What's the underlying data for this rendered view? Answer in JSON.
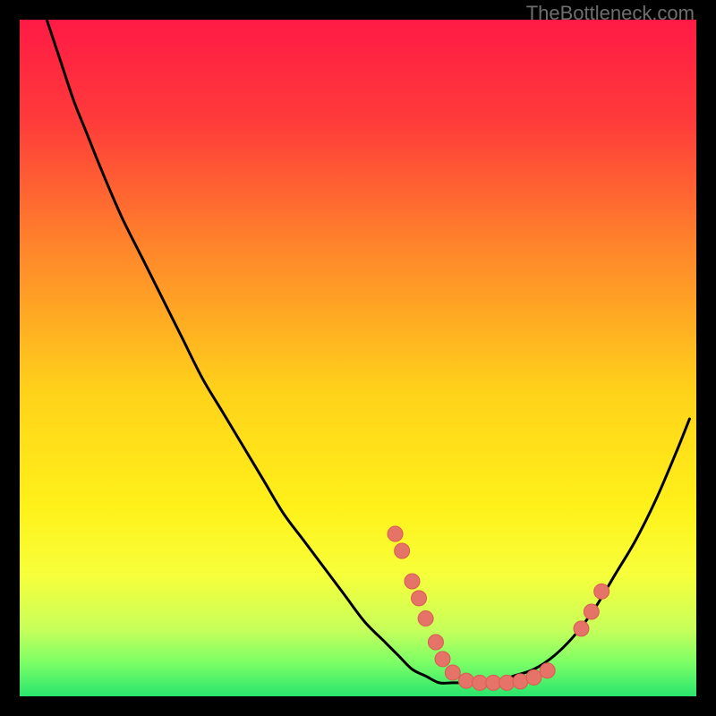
{
  "watermark": "TheBottleneck.com",
  "colors": {
    "background": "#000000",
    "curve": "#000000",
    "marker_fill": "#e57368",
    "marker_stroke": "#d95b52",
    "gradient_stops": [
      {
        "offset": 0.0,
        "color": "#ff1a45"
      },
      {
        "offset": 0.15,
        "color": "#ff3b3a"
      },
      {
        "offset": 0.35,
        "color": "#ff8a2a"
      },
      {
        "offset": 0.55,
        "color": "#ffd21a"
      },
      {
        "offset": 0.72,
        "color": "#fff11a"
      },
      {
        "offset": 0.82,
        "color": "#f7ff3a"
      },
      {
        "offset": 0.9,
        "color": "#c8ff5a"
      },
      {
        "offset": 0.95,
        "color": "#7dff66"
      },
      {
        "offset": 1.0,
        "color": "#29e56d"
      }
    ]
  },
  "chart_data": {
    "type": "line",
    "title": "",
    "xlabel": "",
    "ylabel": "",
    "xlim": [
      0,
      100
    ],
    "ylim": [
      0,
      100
    ],
    "series": [
      {
        "name": "bottleneck-curve",
        "x": [
          4,
          6,
          8,
          10,
          12,
          15,
          18,
          21,
          24,
          27,
          30,
          33,
          36,
          39,
          42,
          45,
          48,
          51,
          54,
          56,
          58,
          60,
          62,
          64,
          67,
          70,
          73,
          76,
          79,
          82,
          85,
          88,
          91,
          94,
          97,
          99
        ],
        "y": [
          100,
          94,
          88,
          83,
          78,
          71,
          65,
          59,
          53,
          47,
          42,
          37,
          32,
          27,
          23,
          19,
          15,
          11,
          8,
          6,
          4,
          3,
          2,
          2,
          2,
          2,
          3,
          4,
          6,
          9,
          13,
          18,
          23,
          29,
          36,
          41
        ]
      }
    ],
    "markers": [
      {
        "x": 55.5,
        "y": 24.0
      },
      {
        "x": 56.5,
        "y": 21.5
      },
      {
        "x": 58.0,
        "y": 17.0
      },
      {
        "x": 59.0,
        "y": 14.5
      },
      {
        "x": 60.0,
        "y": 11.5
      },
      {
        "x": 61.5,
        "y": 8.0
      },
      {
        "x": 62.5,
        "y": 5.5
      },
      {
        "x": 64.0,
        "y": 3.5
      },
      {
        "x": 66.0,
        "y": 2.3
      },
      {
        "x": 68.0,
        "y": 2.0
      },
      {
        "x": 70.0,
        "y": 2.0
      },
      {
        "x": 72.0,
        "y": 2.0
      },
      {
        "x": 74.0,
        "y": 2.2
      },
      {
        "x": 76.0,
        "y": 2.8
      },
      {
        "x": 78.0,
        "y": 3.8
      },
      {
        "x": 83.0,
        "y": 10.0
      },
      {
        "x": 84.5,
        "y": 12.5
      },
      {
        "x": 86.0,
        "y": 15.5
      }
    ]
  }
}
